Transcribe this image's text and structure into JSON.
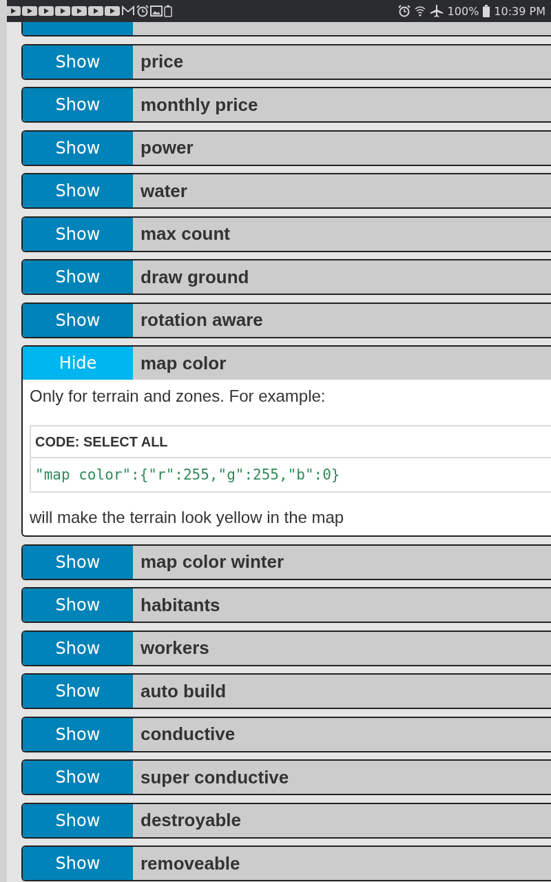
{
  "status_bar": {
    "battery": "100%",
    "time": "10:39 PM"
  },
  "sections": [
    {
      "kind": "clipped"
    },
    {
      "kind": "row",
      "toggle": "Show",
      "label": "price",
      "expanded": false
    },
    {
      "kind": "row",
      "toggle": "Show",
      "label": "monthly price",
      "expanded": false
    },
    {
      "kind": "row",
      "toggle": "Show",
      "label": "power",
      "expanded": false
    },
    {
      "kind": "row",
      "toggle": "Show",
      "label": "water",
      "expanded": false
    },
    {
      "kind": "row",
      "toggle": "Show",
      "label": "max count",
      "expanded": false
    },
    {
      "kind": "row",
      "toggle": "Show",
      "label": "draw ground",
      "expanded": false
    },
    {
      "kind": "row",
      "toggle": "Show",
      "label": "rotation aware",
      "expanded": false
    },
    {
      "kind": "row",
      "toggle": "Hide",
      "label": "map color",
      "expanded": true,
      "body": {
        "intro": "Only for terrain and zones. For example:",
        "code_header": "CODE: SELECT ALL",
        "code": "\"map color\":{\"r\":255,\"g\":255,\"b\":0}",
        "outro": "will make the terrain look yellow in the map"
      }
    },
    {
      "kind": "row",
      "toggle": "Show",
      "label": "map color winter",
      "expanded": false
    },
    {
      "kind": "row",
      "toggle": "Show",
      "label": "habitants",
      "expanded": false
    },
    {
      "kind": "row",
      "toggle": "Show",
      "label": "workers",
      "expanded": false
    },
    {
      "kind": "row",
      "toggle": "Show",
      "label": "auto build",
      "expanded": false
    },
    {
      "kind": "row",
      "toggle": "Show",
      "label": "conductive",
      "expanded": false
    },
    {
      "kind": "row",
      "toggle": "Show",
      "label": "super conductive",
      "expanded": false
    },
    {
      "kind": "row",
      "toggle": "Show",
      "label": "destroyable",
      "expanded": false
    },
    {
      "kind": "row",
      "toggle": "Show",
      "label": "removeable",
      "expanded": false
    }
  ]
}
